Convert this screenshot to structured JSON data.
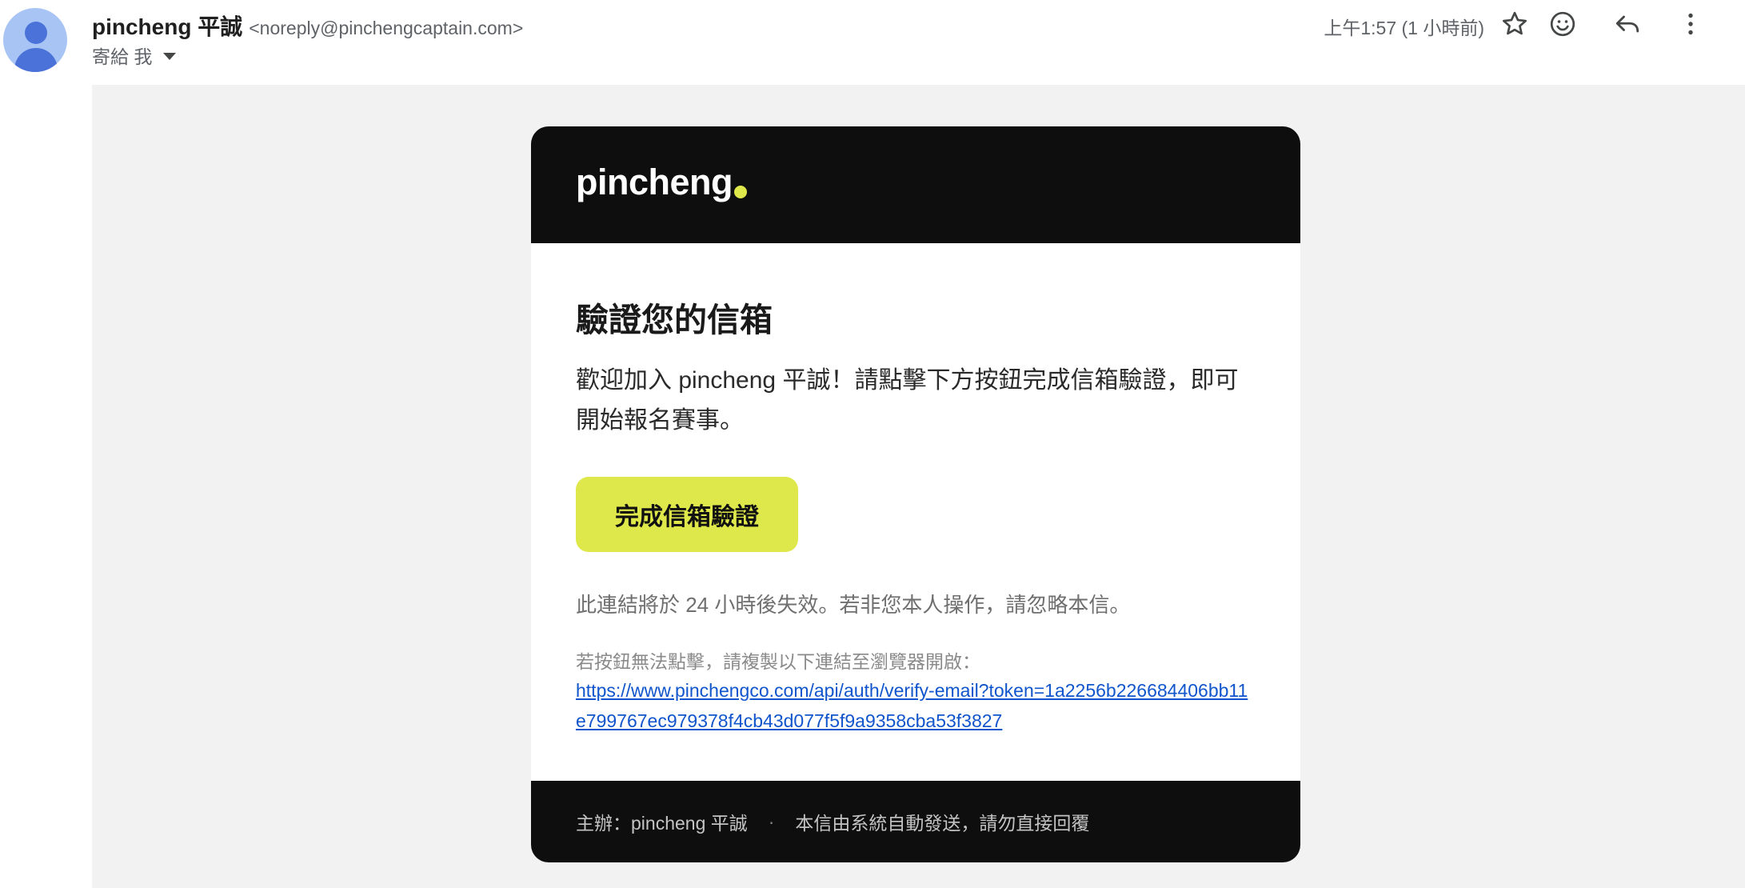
{
  "header": {
    "sender_name": "pincheng 平誠",
    "sender_email": "<noreply@pinchengcaptain.com>",
    "to_label": "寄給 我",
    "timestamp": "上午1:57 (1 小時前)",
    "icons": [
      "person-avatar-icon",
      "star-icon",
      "emoji-icon",
      "reply-icon",
      "more-vert-icon"
    ]
  },
  "email": {
    "logo_text": "pincheng",
    "title": "驗證您的信箱",
    "body": "歡迎加入 pincheng 平誠！請點擊下方按鈕完成信箱驗證，即可開始報名賽事。",
    "button_label": "完成信箱驗證",
    "expiry_note": "此連結將於 24 小時後失效。若非您本人操作，請忽略本信。",
    "fallback_label": "若按鈕無法點擊，請複製以下連結至瀏覽器開啟：",
    "fallback_link": "https://www.pinchengco.com/api/auth/verify-email?token=1a2256b226684406bb11e799767ec979378f4cb43d077f5f9a9358cba53f3827",
    "footer_organizer": "主辦：pincheng 平誠",
    "footer_separator": "·",
    "footer_note": "本信由系統自動發送，請勿直接回覆"
  },
  "colors": {
    "brand_accent": "#dfe84a",
    "card_dark": "#0e0e0e",
    "link": "#1155cc",
    "avatar_bg": "#a8c4f5",
    "avatar_fg": "#4a72d8"
  }
}
